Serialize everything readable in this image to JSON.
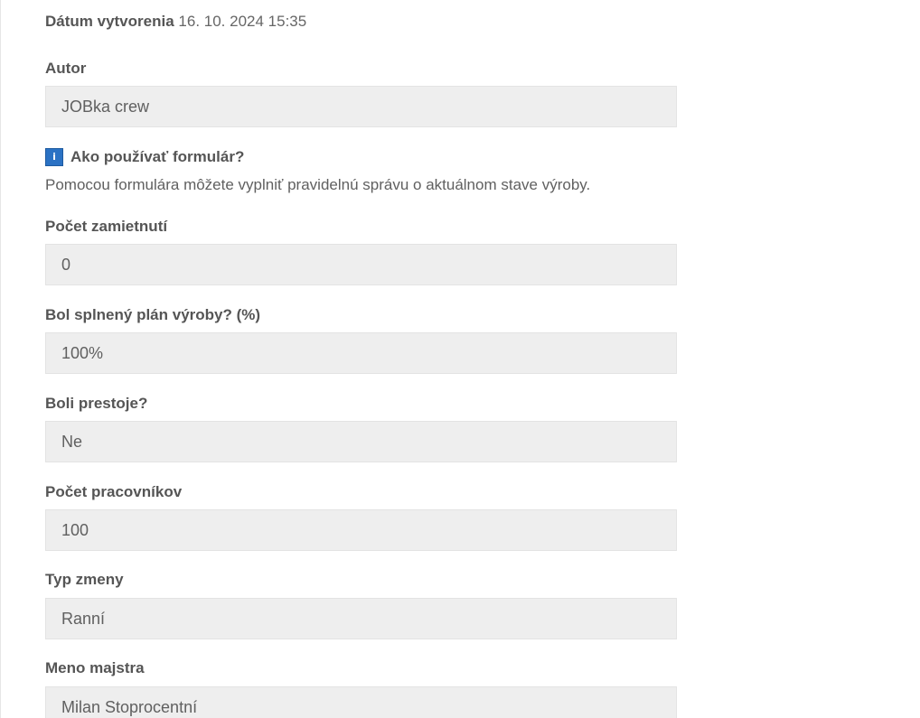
{
  "created": {
    "label": "Dátum vytvorenia",
    "value": "16. 10. 2024 15:35"
  },
  "info": {
    "icon": "info-icon",
    "icon_glyph": "i",
    "title": "Ako používať formulár?",
    "text": "Pomocou formulára môžete vyplniť pravidelnú správu o aktuálnom stave výroby."
  },
  "fields": {
    "author": {
      "label": "Autor",
      "value": "JOBka crew"
    },
    "rejections": {
      "label": "Počet zamietnutí",
      "value": "0"
    },
    "plan": {
      "label": "Bol splnený plán výroby? (%)",
      "value": "100%"
    },
    "downtime": {
      "label": "Boli prestoje?",
      "value": "Ne"
    },
    "workers": {
      "label": "Počet pracovníkov",
      "value": "100"
    },
    "shift": {
      "label": "Typ zmeny",
      "value": "Ranní"
    },
    "foreman": {
      "label": "Meno majstra",
      "value": "Milan Stoprocentní"
    }
  },
  "colors": {
    "input_bg": "#eeeeee",
    "info_icon": "#2b72c4"
  }
}
